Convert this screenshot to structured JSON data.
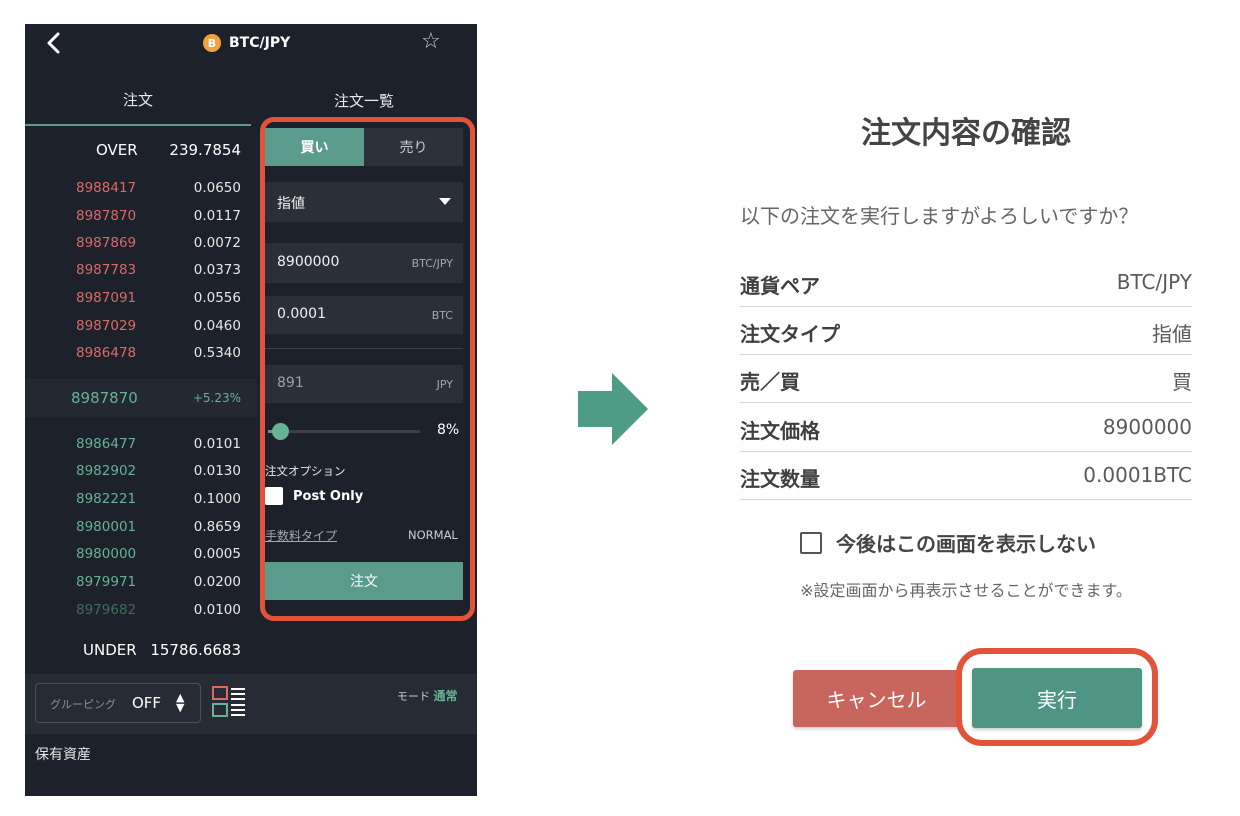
{
  "phone": {
    "pair": "BTC/JPY",
    "coin_symbol": "B",
    "tabs": [
      "注文",
      "注文一覧"
    ],
    "book": {
      "over_label": "OVER",
      "over_value": "239.7854",
      "asks": [
        {
          "price": "8988417",
          "size": "0.0650"
        },
        {
          "price": "8987870",
          "size": "0.0117"
        },
        {
          "price": "8987869",
          "size": "0.0072"
        },
        {
          "price": "8987783",
          "size": "0.0373"
        },
        {
          "price": "8987091",
          "size": "0.0556"
        },
        {
          "price": "8987029",
          "size": "0.0460"
        },
        {
          "price": "8986478",
          "size": "0.5340"
        }
      ],
      "mid_price": "8987870",
      "mid_change": "+5.23%",
      "bids": [
        {
          "price": "8986477",
          "size": "0.0101"
        },
        {
          "price": "8982902",
          "size": "0.0130"
        },
        {
          "price": "8982221",
          "size": "0.1000"
        },
        {
          "price": "8980001",
          "size": "0.8659"
        },
        {
          "price": "8980000",
          "size": "0.0005"
        },
        {
          "price": "8979971",
          "size": "0.0200"
        },
        {
          "price": "8979682",
          "size": "0.0100"
        }
      ],
      "under_label": "UNDER",
      "under_value": "15786.6683"
    },
    "form": {
      "buy_label": "買い",
      "sell_label": "売り",
      "order_type": "指値",
      "price_value": "8900000",
      "price_unit": "BTC/JPY",
      "amount_value": "0.0001",
      "amount_unit": "BTC",
      "total_value": "891",
      "total_unit": "JPY",
      "slider_percent": 8,
      "slider_label": "8%",
      "option_label": "注文オプション",
      "post_only_label": "Post Only",
      "fee_label": "手数料タイプ",
      "fee_value": "NORMAL",
      "order_button": "注文"
    },
    "bottom": {
      "grouping_label": "グルーピング",
      "grouping_value": "OFF",
      "mode_label": "モード",
      "mode_value": "通常",
      "assets_label": "保有資産"
    }
  },
  "dialog": {
    "title": "注文内容の確認",
    "question": "以下の注文を実行しますがよろしいですか？",
    "rows": [
      {
        "label": "通貨ペア",
        "value": "BTC/JPY"
      },
      {
        "label": "注文タイプ",
        "value": "指値"
      },
      {
        "label": "売／買",
        "value": "買"
      },
      {
        "label": "注文価格",
        "value": "8900000"
      },
      {
        "label": "注文数量",
        "value": "0.0001BTC"
      }
    ],
    "dont_show_label": "今後はこの画面を表示しない",
    "note": "※設定画面から再表示させることができます。",
    "cancel_label": "キャンセル",
    "execute_label": "実行"
  },
  "colors": {
    "accent": "#5b9b8c",
    "highlight": "#e2543a",
    "cancel": "#c8665e",
    "ask": "#d96a66",
    "bid": "#65b294"
  }
}
